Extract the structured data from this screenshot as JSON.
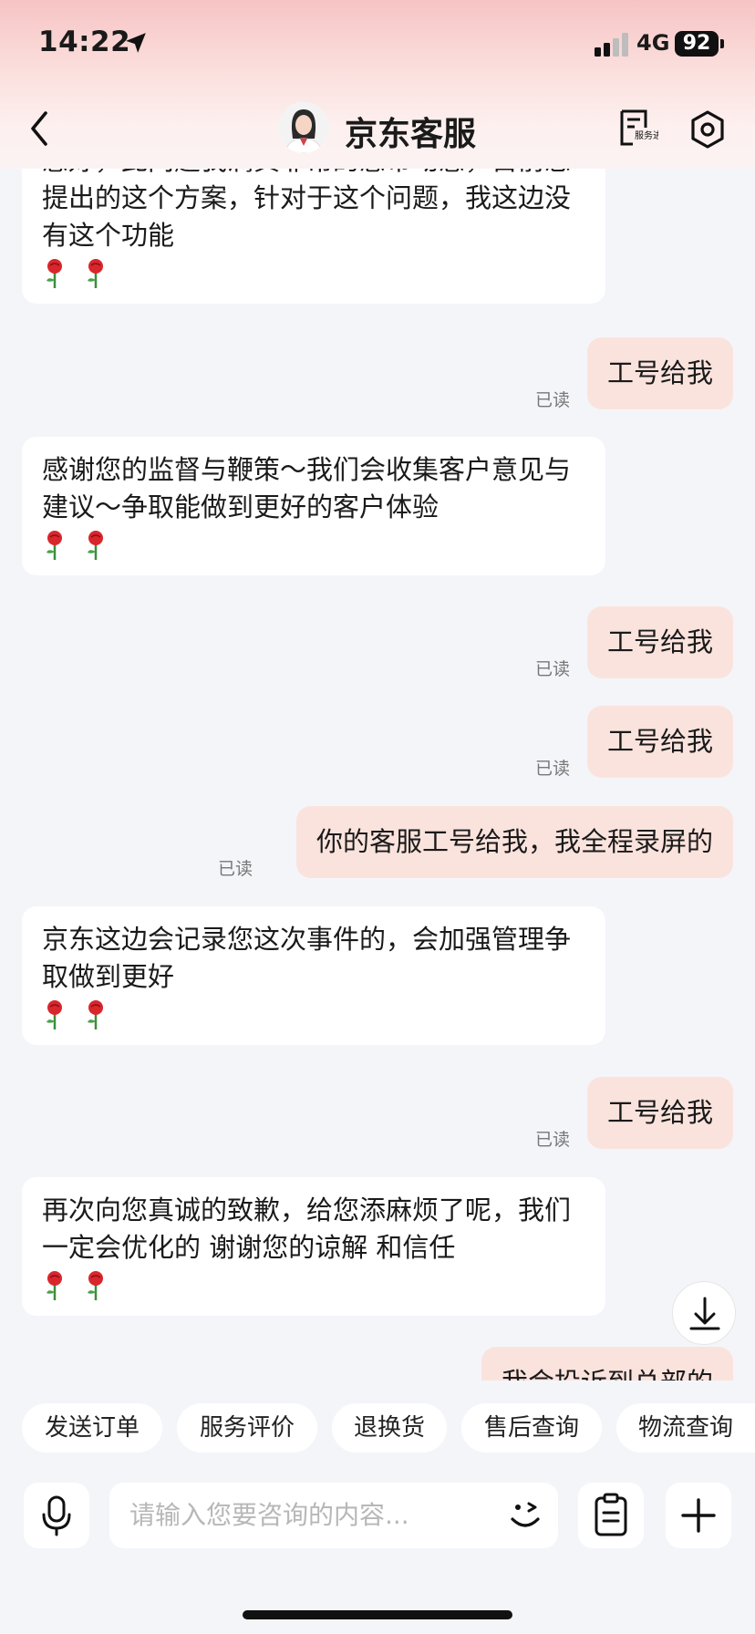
{
  "status_bar": {
    "time": "14:22",
    "network": "4G",
    "battery": "92"
  },
  "header": {
    "title": "京东客服",
    "service_progress_label": "服务进度"
  },
  "messages": [
    {
      "side": "left",
      "text": "感好，此问题我满真非常的感带动感，目前您提出的这个方案，针对于这个问题，我这边没有这个功能",
      "roses": 2
    },
    {
      "side": "right",
      "text": "工号给我",
      "read": "已读"
    },
    {
      "side": "left",
      "text": "感谢您的监督与鞭策～我们会收集客户意见与建议～争取能做到更好的客户体验",
      "roses": 2
    },
    {
      "side": "right",
      "text": "工号给我",
      "read": "已读"
    },
    {
      "side": "right",
      "text": "工号给我",
      "read": "已读"
    },
    {
      "side": "right",
      "text": "你的客服工号给我，我全程录屏的",
      "read": "已读"
    },
    {
      "side": "left",
      "text": "京东这边会记录您这次事件的，会加强管理争取做到更好",
      "roses": 2
    },
    {
      "side": "right",
      "text": "工号给我",
      "read": "已读"
    },
    {
      "side": "left",
      "text": "再次向您真诚的致歉，给您添麻烦了呢，我们一定会优化的 谢谢您的谅解 和信任",
      "roses": 2
    },
    {
      "side": "right",
      "text": "我会投诉到总部的"
    }
  ],
  "quick_actions": [
    "发送订单",
    "服务评价",
    "退换货",
    "售后查询",
    "物流查询"
  ],
  "input": {
    "placeholder": "请输入您要咨询的内容..."
  },
  "icons": {
    "location": "location-arrow-icon",
    "back": "chevron-left-icon",
    "service_progress": "service-progress-icon",
    "settings": "gear-icon",
    "download": "download-icon",
    "mic": "microphone-icon",
    "emoji": "emoji-icon",
    "clipboard": "clipboard-icon",
    "plus": "plus-icon"
  },
  "colors": {
    "bubble_right": "#fbe3dd",
    "bubble_left": "#ffffff",
    "background": "#f4f5f9"
  }
}
